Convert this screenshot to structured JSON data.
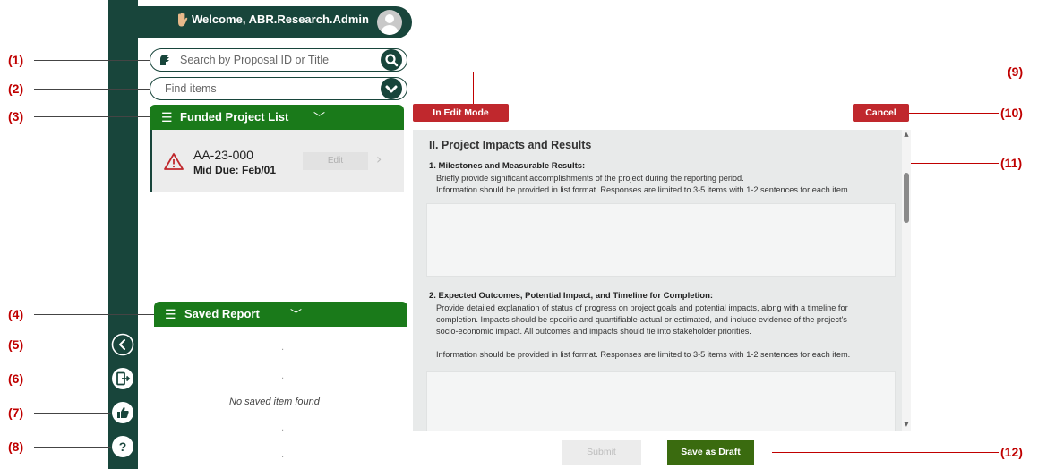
{
  "header": {
    "welcome_text": "Welcome, ABR.Research.Admin",
    "wave_icon": "waving-hand-icon",
    "avatar_icon": "user-avatar-icon"
  },
  "search": {
    "placeholder": "Search by Proposal ID or Title",
    "icon": "search-icon",
    "logo_icon": "spartan-helmet-icon"
  },
  "find": {
    "placeholder": "Find items",
    "icon": "chevron-down-icon"
  },
  "funded": {
    "label": "Funded Project List",
    "items": [
      {
        "id": "AA-23-000",
        "due": "Mid Due: Feb/01",
        "edit_label": "Edit"
      }
    ]
  },
  "saved": {
    "label": "Saved Report",
    "empty_text": "No saved item found"
  },
  "rail": {
    "icons": [
      "collapse-left-icon",
      "logout-icon",
      "thumbs-up-icon",
      "help-icon"
    ]
  },
  "form": {
    "mode_label": "In Edit Mode",
    "cancel_label": "Cancel",
    "section_title": "II. Project Impacts and Results",
    "q1": {
      "title": "1. Milestones and Measurable Results:",
      "desc1": "Briefly provide significant accomplishments of the project during the reporting period.",
      "desc2": "Information should be provided in list format. Responses are limited to 3-5 items with 1-2 sentences for each item."
    },
    "q2": {
      "title": "2. Expected Outcomes, Potential Impact, and Timeline for Completion:",
      "desc1": "Provide detailed explanation of status of progress on project goals and potential impacts, along with a timeline for",
      "desc2": "completion. Impacts should be specific and quantifiable-actual or estimated, and include evidence of the project's",
      "desc3": "socio-economic impact. All outcomes and impacts should tie into stakeholder priorities.",
      "desc4": "Information should be provided in list format. Responses are limited to 3-5 items with 1-2 sentences for each item."
    },
    "submit_label": "Submit",
    "draft_label": "Save as Draft"
  },
  "annotations": {
    "c1": "(1)",
    "c2": "(2)",
    "c3": "(3)",
    "c4": "(4)",
    "c5": "(5)",
    "c6": "(6)",
    "c7": "(7)",
    "c8": "(8)",
    "c9": "(9)",
    "c10": "(10)",
    "c11": "(11)",
    "c12": "(12)"
  },
  "colors": {
    "brand_green": "#18453b",
    "section_green": "#1a7a1a",
    "accent_red": "#c0282d",
    "draft_green": "#3a6b0f",
    "annotation_red": "#c00000"
  }
}
